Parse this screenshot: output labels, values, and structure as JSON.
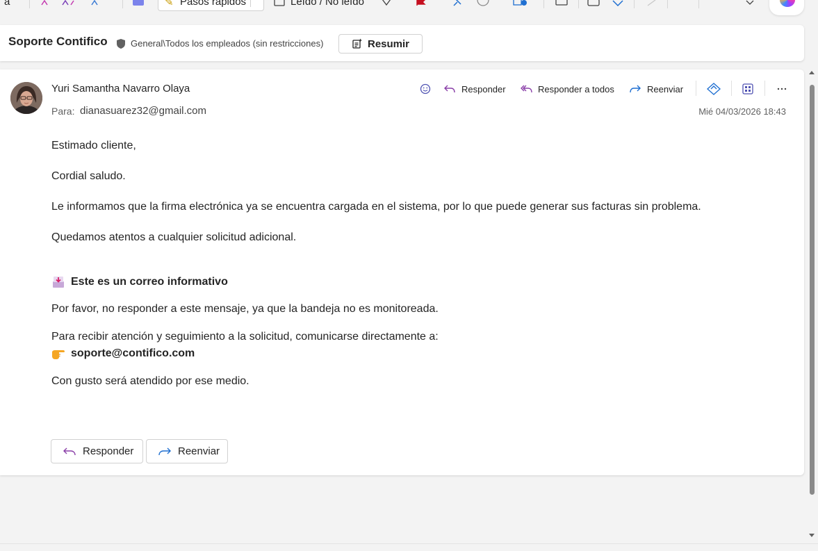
{
  "toolbar": {
    "cut_left": "a",
    "quick_steps": "Pasos rápidos",
    "read_unread": "Leído / No leído"
  },
  "subject": {
    "title": "Soporte Contifico",
    "sensitivity": "General\\Todos los empleados (sin restricciones)",
    "summarize_label": "Resumir"
  },
  "message": {
    "sender": "Yuri Samantha Navarro Olaya",
    "to_label": "Para:",
    "to": "dianasuarez32@gmail.com",
    "date": "Mié 04/03/2026 18:43",
    "actions": {
      "reply": "Responder",
      "reply_all": "Responder a todos",
      "forward": "Reenviar"
    },
    "body": {
      "greeting": "Estimado cliente,",
      "salutation": "Cordial saludo.",
      "p1": "Le informamos que la firma electrónica ya se encuentra cargada en el sistema, por lo que puede generar sus facturas sin problema.",
      "p2": "Quedamos atentos a cualquier solicitud adicional.",
      "notice_heading": "Este es un correo informativo",
      "p3": "Por favor, no responder a este mensaje, ya que la bandeja no es monitoreada.",
      "p4": "Para recibir atención y seguimiento a la solicitud, comunicarse directamente a:",
      "support_email": "soporte@contifico.com",
      "p5": "Con gusto será atendido por ese medio."
    },
    "footer_reply": "Responder",
    "footer_forward": "Reenviar"
  },
  "colors": {
    "reply_icon": "#8a3fa8",
    "forward_icon": "#1f6fd1",
    "accent": "#4f52b2"
  }
}
